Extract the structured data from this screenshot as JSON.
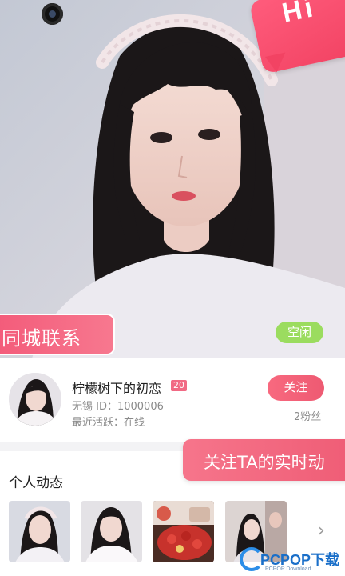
{
  "hero": {
    "promo_text": "Hi",
    "city_banner": "同城联系",
    "status_badge": "空闲"
  },
  "profile": {
    "nickname": "柠檬树下的初恋",
    "age": "20",
    "user_id": "无锡 ID：1000006",
    "last_active": "最近活跃：在线",
    "follow_label": "关注",
    "fans": "2粉丝"
  },
  "follow_banner": "关注TA的实时动",
  "moments": {
    "title": "个人动态",
    "thumbnails": [
      {
        "name": "moment-photo-1"
      },
      {
        "name": "moment-photo-2"
      },
      {
        "name": "moment-photo-3"
      },
      {
        "name": "moment-photo-4"
      }
    ],
    "more_icon": "chevron-right-icon"
  },
  "watermark": {
    "logo_text": "PCPOP下载",
    "sub_text": "PCPOP Download"
  },
  "colors": {
    "accent": "#f2546f",
    "idle": "#9bdc5f",
    "muted_text": "#8a8a8a"
  }
}
